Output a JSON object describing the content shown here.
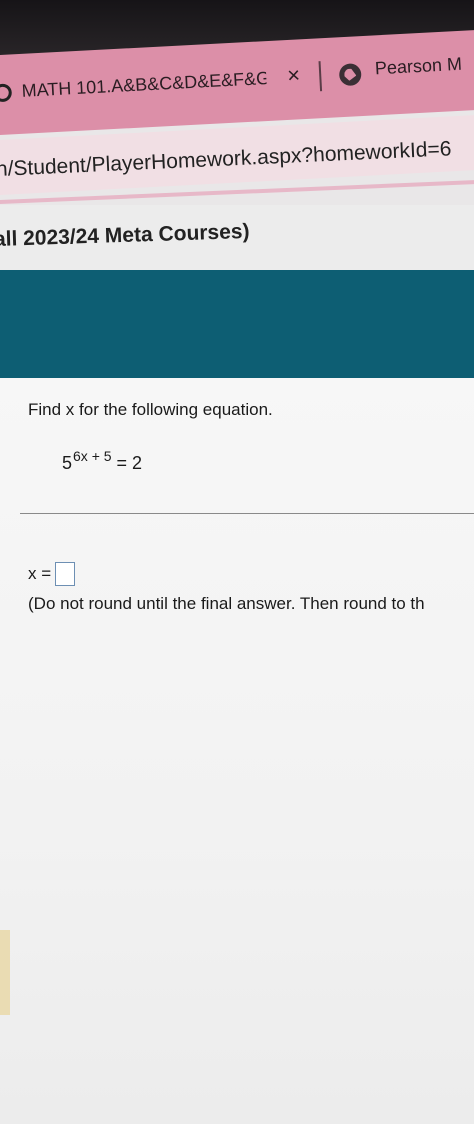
{
  "browser": {
    "tab_title": "MATH 101.A&B&C&D&E&F&G&",
    "tab_close_glyph": "×",
    "tab2_title": "Pearson M",
    "url": "n/Student/PlayerHomework.aspx?homeworkId=6"
  },
  "course": {
    "title": "all 2023/24 Meta Courses)"
  },
  "problem": {
    "prompt": "Find x for the following equation.",
    "equation_base": "5",
    "equation_exponent": "6x + 5",
    "equation_rhs": " = 2",
    "answer_label": "x =",
    "answer_value": "",
    "instruction": "(Do not round until the final answer. Then round to th"
  },
  "colors": {
    "tab_bg": "#dc8fa8",
    "url_bg": "#f1dfe4",
    "banner": "#0d5e73",
    "answer_border": "#6d8fb3"
  },
  "icons": {
    "tab_favicon": "pearson-circle-icon",
    "tab_close": "close-icon"
  }
}
